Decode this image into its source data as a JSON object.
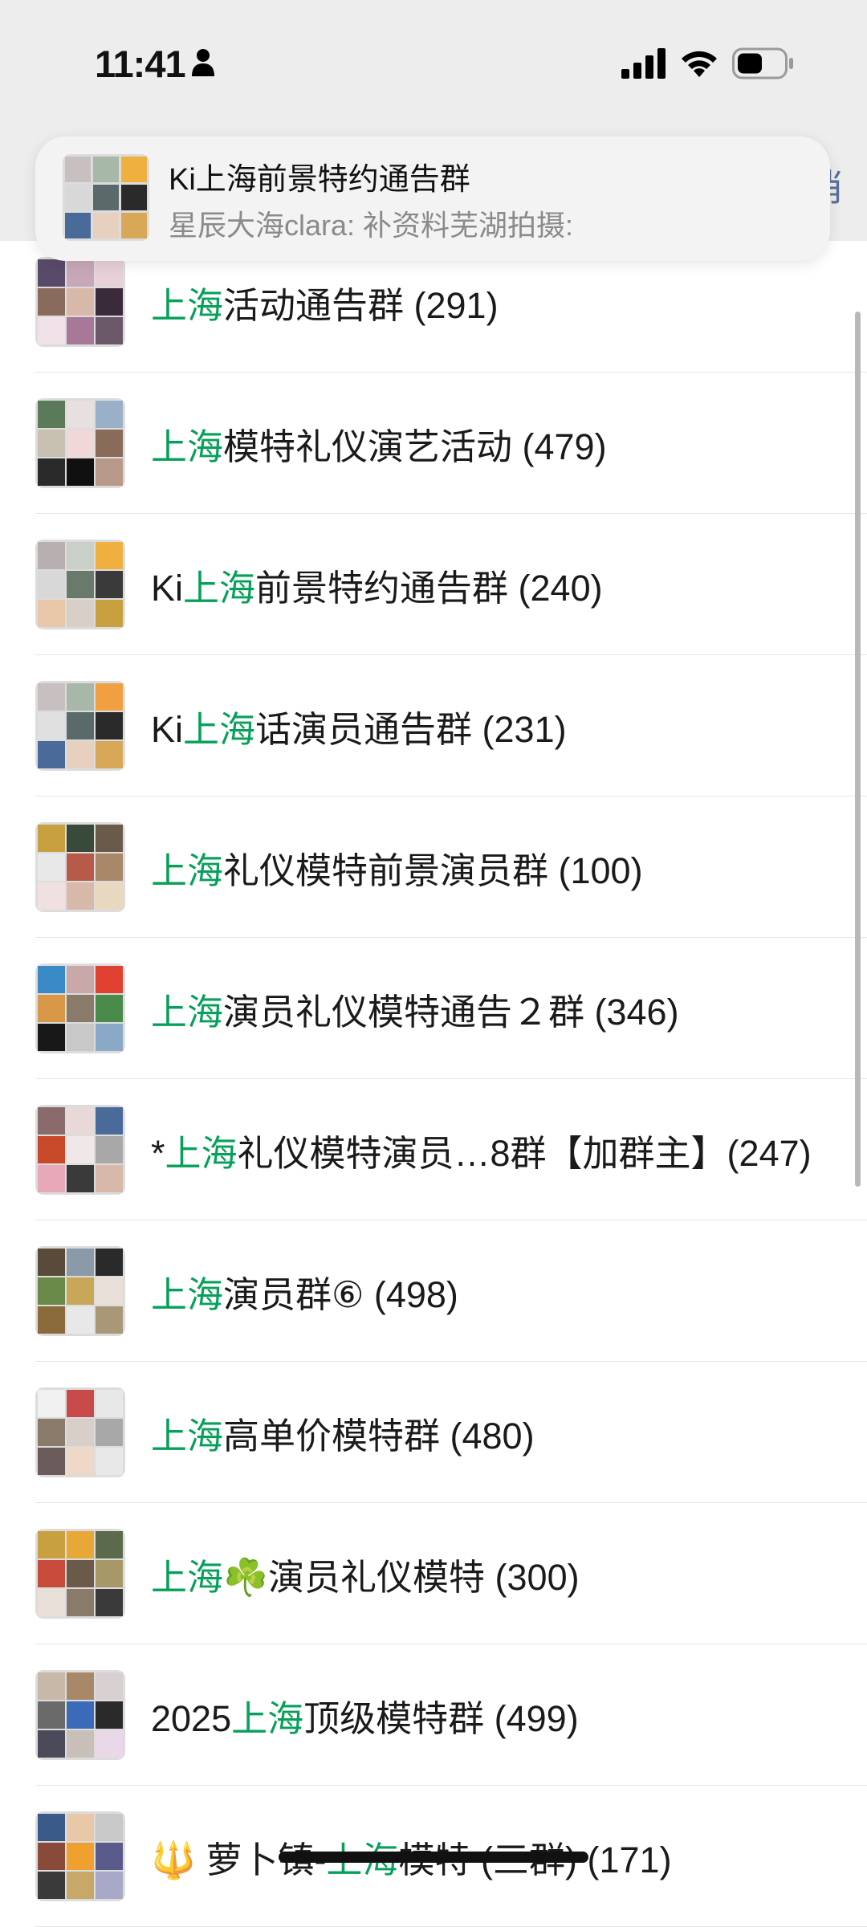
{
  "status_bar": {
    "time": "11:41",
    "icons": [
      "person-icon",
      "cellular-signal-icon",
      "wifi-icon",
      "battery-icon"
    ]
  },
  "cancel_peek": "消",
  "notification": {
    "title": "Ki上海前景特约通告群",
    "body": "星辰大海clara: 补资料芜湖拍摄:"
  },
  "highlight_color": "#07a05a",
  "groups": [
    {
      "pre": "",
      "hl": "上海",
      "post": "活动通告群 (291)",
      "palette": [
        "#5a4a6a",
        "#c8a8b8",
        "#e8d0d8",
        "#8a6a5a",
        "#d8b8a8",
        "#3a2a3a",
        "#f0e0e8",
        "#a87898",
        "#6a5868"
      ]
    },
    {
      "pre": "",
      "hl": "上海",
      "post": "模特礼仪演艺活动 (479)",
      "palette": [
        "#5a7a5a",
        "#e8e0e0",
        "#9ab0c8",
        "#c8c0b0",
        "#f0d8d8",
        "#8a6a58",
        "#2a2a2a",
        "#101010",
        "#b89888"
      ]
    },
    {
      "pre": "Ki",
      "hl": "上海",
      "post": "前景特约通告群 (240)",
      "palette": [
        "#b8b0b0",
        "#c8d0c8",
        "#f0b040",
        "#d8d8d8",
        "#6a7a6a",
        "#3a3a3a",
        "#e8c8a8",
        "#d8d0c8",
        "#c8a040"
      ]
    },
    {
      "pre": "Ki",
      "hl": "上海",
      "post": "话演员通告群 (231)",
      "palette": [
        "#c8c0c0",
        "#a8b8a8",
        "#f0a040",
        "#e0e0e0",
        "#5a6a6a",
        "#2a2a2a",
        "#4a6a9a",
        "#e8d0c0",
        "#d8a858"
      ]
    },
    {
      "pre": "",
      "hl": "上海",
      "post": "礼仪模特前景演员群 (100)",
      "palette": [
        "#c8a040",
        "#3a4a3a",
        "#6a5a4a",
        "#e8e8e8",
        "#b85a4a",
        "#a88868",
        "#f0e0e0",
        "#d8b8a8",
        "#e8d8c0"
      ]
    },
    {
      "pre": "",
      "hl": "上海",
      "post": "演员礼仪模特通告２群 (346)",
      "palette": [
        "#3a8ac8",
        "#c8a8a8",
        "#e04030",
        "#d89848",
        "#8a7a6a",
        "#4a8a4a",
        "#181818",
        "#c8c8c8",
        "#8aa8c8"
      ]
    },
    {
      "pre": "*",
      "hl": "上海",
      "post": "礼仪模特演员…8群【加群主】(247)",
      "palette": [
        "#8a6a6a",
        "#e8d8d8",
        "#4a6a9a",
        "#c84a2a",
        "#f0e8e8",
        "#a8a8a8",
        "#e8a8b8",
        "#3a3a3a",
        "#d8b8a8"
      ]
    },
    {
      "pre": "",
      "hl": "上海",
      "post": "演员群⑥ (498)",
      "palette": [
        "#5a4a3a",
        "#8a9aa8",
        "#2a2a2a",
        "#6a8a4a",
        "#c8a858",
        "#e8e0d8",
        "#8a6a3a",
        "#e8e8e8",
        "#a89878"
      ]
    },
    {
      "pre": "",
      "hl": "上海",
      "post": "高单价模特群 (480)",
      "palette": [
        "#f0f0f0",
        "#c84a4a",
        "#e8e8e8",
        "#8a7a6a",
        "#d8d0c8",
        "#a8a8a8",
        "#6a5a5a",
        "#f0d8c8",
        "#e8e8e8"
      ]
    },
    {
      "pre": "",
      "hl": "上海",
      "post": "☘️演员礼仪模特 (300)",
      "palette": [
        "#c8a040",
        "#e8a838",
        "#5a6a4a",
        "#c84a3a",
        "#6a5a4a",
        "#a89868",
        "#e8e0d8",
        "#8a7a6a",
        "#3a3a3a"
      ]
    },
    {
      "pre": "2025",
      "hl": "上海",
      "post": "顶级模特群 (499)",
      "palette": [
        "#c8b8a8",
        "#a88868",
        "#d8d0d0",
        "#6a6a6a",
        "#3a6ab8",
        "#2a2a2a",
        "#4a4a5a",
        "#c8c0b8",
        "#e8d8e8"
      ]
    },
    {
      "pre": "🔱 萝卜镇-",
      "hl": "上海",
      "post": "模特 (三群) (171)",
      "palette": [
        "#3a5a8a",
        "#e8c8a8",
        "#c8c8c8",
        "#8a4a3a",
        "#f0a030",
        "#5a5a8a",
        "#3a3a3a",
        "#c8a868",
        "#a8a8c8"
      ]
    }
  ]
}
